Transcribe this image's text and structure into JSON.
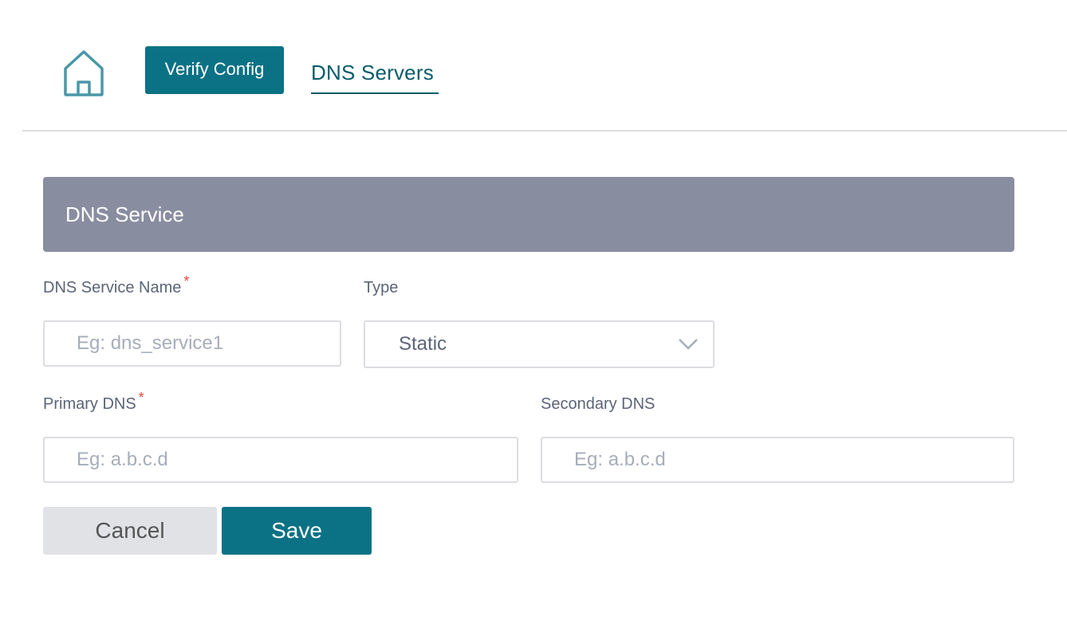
{
  "header": {
    "home_icon": "home-icon",
    "verify_button_label": "Verify Config",
    "active_tab_label": "DNS Servers"
  },
  "panel": {
    "title": "DNS Service"
  },
  "form": {
    "service_name": {
      "label": "DNS Service Name",
      "required_marker": "*",
      "value": "",
      "placeholder": "Eg: dns_service1"
    },
    "type": {
      "label": "Type",
      "selected": "Static",
      "icon": "chevron-down-icon"
    },
    "primary_dns": {
      "label": "Primary DNS",
      "required_marker": "*",
      "value": "",
      "placeholder": "Eg: a.b.c.d"
    },
    "secondary_dns": {
      "label": "Secondary DNS",
      "value": "",
      "placeholder": "Eg: a.b.c.d"
    }
  },
  "actions": {
    "cancel_label": "Cancel",
    "save_label": "Save"
  },
  "colors": {
    "primary": "#0b7285",
    "panel_header": "#898da0",
    "required": "#e8453c"
  }
}
